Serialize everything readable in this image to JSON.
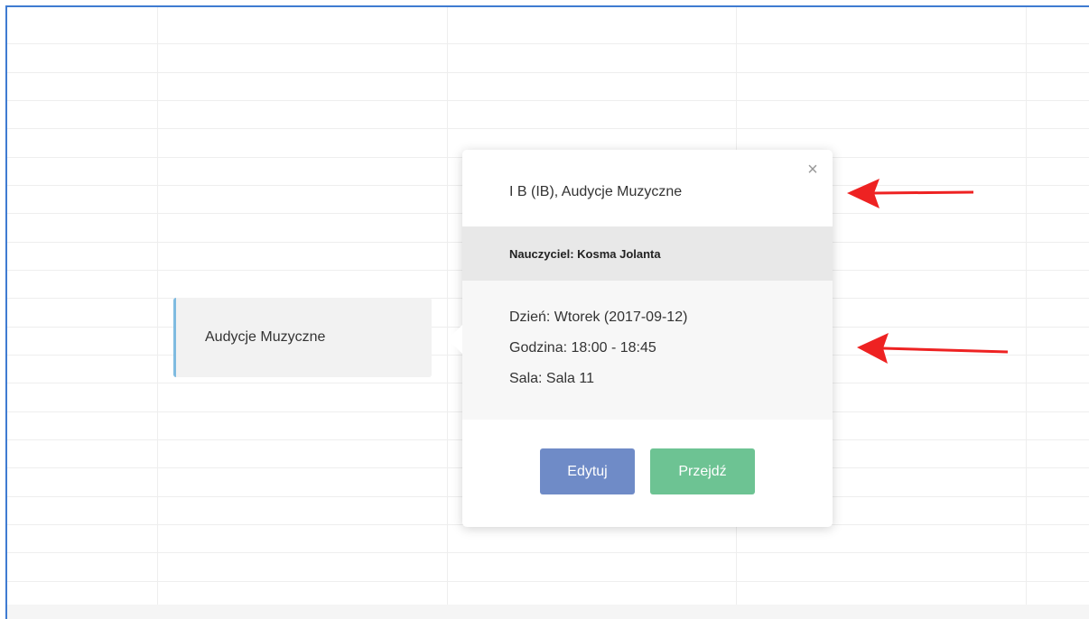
{
  "event": {
    "label": "Audycje Muzyczne"
  },
  "popover": {
    "title": "I B (IB), Audycje Muzyczne",
    "close_icon": "×",
    "teacher": "Nauczyciel: Kosma Jolanta",
    "details": {
      "day": "Dzień: Wtorek (2017-09-12)",
      "time": "Godzina: 18:00 - 18:45",
      "room": "Sala: Sala 11"
    },
    "buttons": {
      "edit_label": "Edytuj",
      "go_label": "Przejdź"
    }
  },
  "colors": {
    "frame_border": "#3f7bd1",
    "event_accent": "#7fbbe0",
    "edit_button": "#6f8bc7",
    "go_button": "#6dc393",
    "annotation_arrow": "#ee2222"
  }
}
